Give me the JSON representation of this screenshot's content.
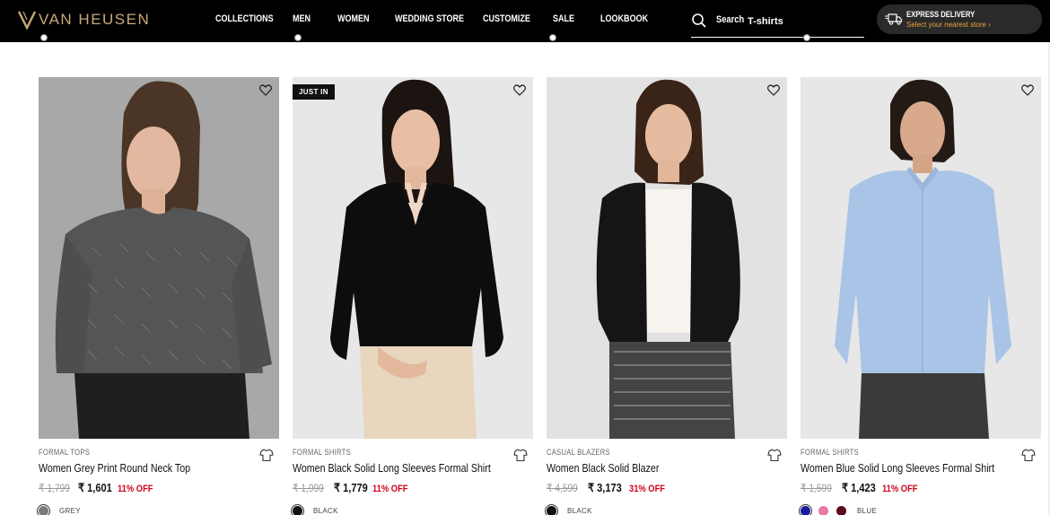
{
  "brand": {
    "name": "VAN HEUSEN",
    "accent": "#c9a97a"
  },
  "nav": [
    "COLLECTIONS",
    "MEN",
    "WOMEN",
    "WEDDING STORE",
    "CUSTOMIZE",
    "SALE",
    "LOOKBOOK"
  ],
  "search": {
    "label": "Search",
    "placeholder": "T-shirts"
  },
  "express": {
    "title": "EXPRESS DELIVERY",
    "subtitle": "Select your nearest store ›"
  },
  "products": [
    {
      "badge": "",
      "category": "FORMAL TOPS",
      "title": "Women Grey Print Round Neck Top",
      "mrp": "₹ 1,799",
      "price": "₹ 1,601",
      "discount": "11% OFF",
      "image": "woman-grey-print-top",
      "swatches": [
        "#7a7a7a"
      ],
      "color_label": "GREY"
    },
    {
      "badge": "JUST IN",
      "category": "FORMAL SHIRTS",
      "title": "Women Black Solid Long Sleeves Formal Shirt",
      "mrp": "₹ 1,999",
      "price": "₹ 1,779",
      "discount": "11% OFF",
      "image": "woman-black-shirt",
      "swatches": [
        "#111111"
      ],
      "color_label": "BLACK"
    },
    {
      "badge": "",
      "category": "CASUAL BLAZERS",
      "title": "Women Black Solid Blazer",
      "mrp": "₹ 4,599",
      "price": "₹ 3,173",
      "discount": "31% OFF",
      "image": "woman-black-blazer",
      "swatches": [
        "#111111"
      ],
      "color_label": "BLACK"
    },
    {
      "badge": "",
      "category": "FORMAL SHIRTS",
      "title": "Women Blue Solid Long Sleeves Formal Shirt",
      "mrp": "₹ 1,599",
      "price": "₹ 1,423",
      "discount": "11% OFF",
      "image": "woman-blue-shirt",
      "swatches": [
        "#1a1aa0",
        "#e87aa6",
        "#5a0a1a"
      ],
      "color_label": "BLUE"
    }
  ]
}
